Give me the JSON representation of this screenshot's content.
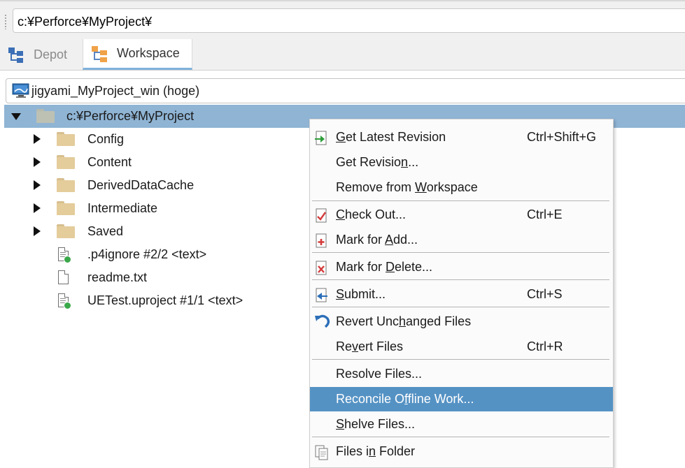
{
  "path_bar": {
    "value": "c:¥Perforce¥MyProject¥"
  },
  "tabs": [
    {
      "label": "Depot",
      "icon": "depot-tree-icon",
      "active": false
    },
    {
      "label": "Workspace",
      "icon": "workspace-tree-icon",
      "active": true
    }
  ],
  "workspace": {
    "name": "jigyami_MyProject_win (hoge)",
    "icon": "workspace-monitor-icon"
  },
  "tree": {
    "root": {
      "label": "c:¥Perforce¥MyProject",
      "expanded": true,
      "selected": true
    },
    "items": [
      {
        "label": "Config",
        "kind": "folder"
      },
      {
        "label": "Content",
        "kind": "folder"
      },
      {
        "label": "DerivedDataCache",
        "kind": "folder"
      },
      {
        "label": "Intermediate",
        "kind": "folder"
      },
      {
        "label": "Saved",
        "kind": "folder"
      },
      {
        "label": ".p4ignore #2/2 <text>",
        "kind": "file-in-depot"
      },
      {
        "label": "readme.txt",
        "kind": "file-local"
      },
      {
        "label": "UETest.uproject #1/1 <text>",
        "kind": "file-in-depot"
      }
    ]
  },
  "context_menu": {
    "highlight_color": "#5592c4",
    "items": [
      {
        "pre": "",
        "u": "G",
        "post": "et Latest Revision",
        "shortcut": "Ctrl+Shift+G",
        "icon": "get-latest-icon"
      },
      {
        "pre": "Get Revisio",
        "u": "n",
        "post": "...",
        "shortcut": "",
        "icon": ""
      },
      {
        "pre": "Remove from ",
        "u": "W",
        "post": "orkspace",
        "shortcut": "",
        "icon": ""
      },
      {
        "pre": "",
        "u": "C",
        "post": "heck Out...",
        "shortcut": "Ctrl+E",
        "icon": "check-out-icon"
      },
      {
        "pre": "Mark for ",
        "u": "A",
        "post": "dd...",
        "shortcut": "",
        "icon": "mark-for-add-icon"
      },
      {
        "pre": "Mark for ",
        "u": "D",
        "post": "elete...",
        "shortcut": "",
        "icon": "mark-for-delete-icon"
      },
      {
        "pre": "",
        "u": "S",
        "post": "ubmit...",
        "shortcut": "Ctrl+S",
        "icon": "submit-icon"
      },
      {
        "pre": "Revert Unc",
        "u": "h",
        "post": "anged Files",
        "shortcut": "",
        "icon": "revert-icon"
      },
      {
        "pre": "Re",
        "u": "v",
        "post": "ert Files",
        "shortcut": "Ctrl+R",
        "icon": ""
      },
      {
        "pre": "Resolve Files...",
        "u": "",
        "post": "",
        "shortcut": "",
        "icon": ""
      },
      {
        "pre": "Reconcile O",
        "u": "f",
        "post": "fline Work...",
        "shortcut": "",
        "icon": "",
        "highlighted": true
      },
      {
        "pre": "",
        "u": "S",
        "post": "helve Files...",
        "shortcut": "",
        "icon": ""
      },
      {
        "pre": "Files i",
        "u": "n",
        "post": " Folder",
        "shortcut": "",
        "icon": "files-in-folder-icon"
      }
    ]
  }
}
